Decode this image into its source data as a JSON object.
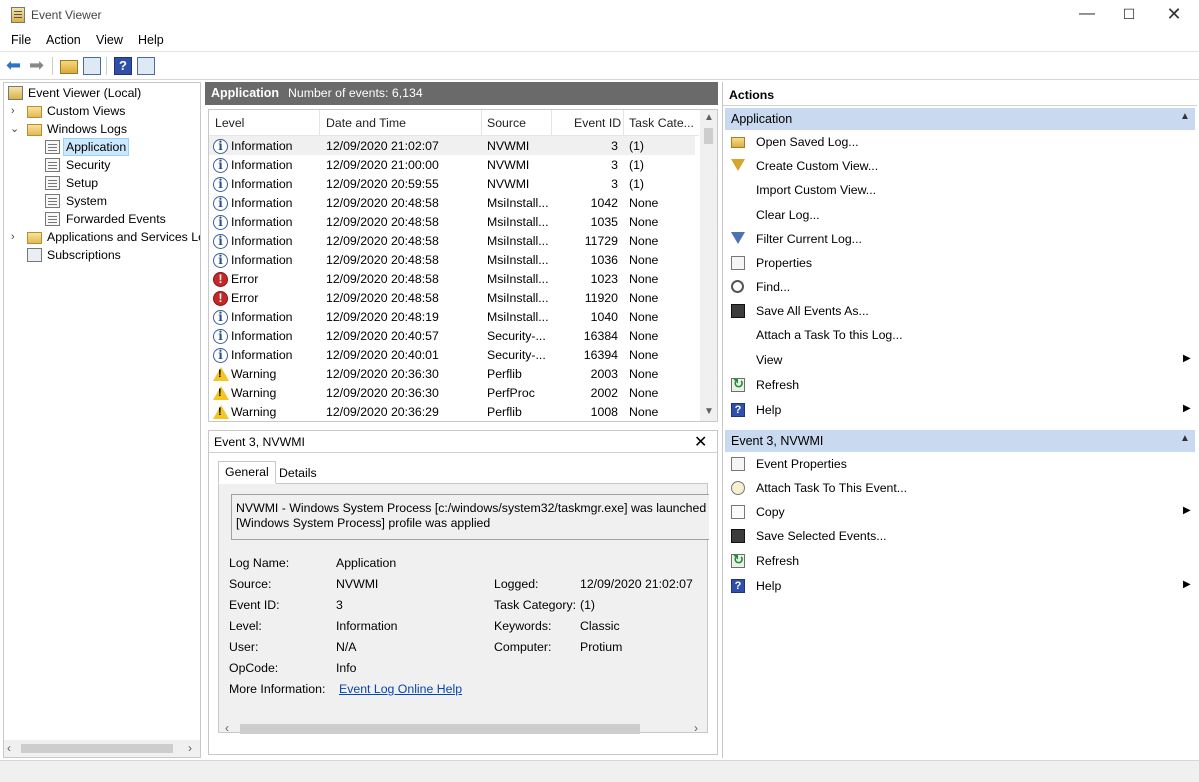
{
  "window": {
    "title": "Event Viewer",
    "min": "—",
    "max": "☐",
    "close": "✕"
  },
  "menu": [
    "File",
    "Action",
    "View",
    "Help"
  ],
  "tree": {
    "items": [
      {
        "label": "Event Viewer (Local)"
      },
      {
        "label": "Custom Views"
      },
      {
        "label": "Windows Logs"
      },
      {
        "label": "Application"
      },
      {
        "label": "Security"
      },
      {
        "label": "Setup"
      },
      {
        "label": "System"
      },
      {
        "label": "Forwarded Events"
      },
      {
        "label": "Applications and Services Logs"
      },
      {
        "label": "Subscriptions"
      }
    ]
  },
  "events_header": {
    "log": "Application",
    "count": "Number of events: 6,134"
  },
  "columns": [
    "Level",
    "Date and Time",
    "Source",
    "Event ID",
    "Task Cate..."
  ],
  "events": [
    {
      "level": "Information",
      "icon": "info-icon",
      "date": "12/09/2020 21:02:07",
      "source": "NVWMI",
      "id": "3",
      "task": "(1)"
    },
    {
      "level": "Information",
      "icon": "info-icon",
      "date": "12/09/2020 21:00:00",
      "source": "NVWMI",
      "id": "3",
      "task": "(1)"
    },
    {
      "level": "Information",
      "icon": "info-icon",
      "date": "12/09/2020 20:59:55",
      "source": "NVWMI",
      "id": "3",
      "task": "(1)"
    },
    {
      "level": "Information",
      "icon": "info-icon",
      "date": "12/09/2020 20:48:58",
      "source": "MsiInstall...",
      "id": "1042",
      "task": "None"
    },
    {
      "level": "Information",
      "icon": "info-icon",
      "date": "12/09/2020 20:48:58",
      "source": "MsiInstall...",
      "id": "1035",
      "task": "None"
    },
    {
      "level": "Information",
      "icon": "info-icon",
      "date": "12/09/2020 20:48:58",
      "source": "MsiInstall...",
      "id": "11729",
      "task": "None"
    },
    {
      "level": "Information",
      "icon": "info-icon",
      "date": "12/09/2020 20:48:58",
      "source": "MsiInstall...",
      "id": "1036",
      "task": "None"
    },
    {
      "level": "Error",
      "icon": "error-icon",
      "date": "12/09/2020 20:48:58",
      "source": "MsiInstall...",
      "id": "1023",
      "task": "None"
    },
    {
      "level": "Error",
      "icon": "error-icon",
      "date": "12/09/2020 20:48:58",
      "source": "MsiInstall...",
      "id": "11920",
      "task": "None"
    },
    {
      "level": "Information",
      "icon": "info-icon",
      "date": "12/09/2020 20:48:19",
      "source": "MsiInstall...",
      "id": "1040",
      "task": "None"
    },
    {
      "level": "Information",
      "icon": "info-icon",
      "date": "12/09/2020 20:40:57",
      "source": "Security-...",
      "id": "16384",
      "task": "None"
    },
    {
      "level": "Information",
      "icon": "info-icon",
      "date": "12/09/2020 20:40:01",
      "source": "Security-...",
      "id": "16394",
      "task": "None"
    },
    {
      "level": "Warning",
      "icon": "warning-icon",
      "date": "12/09/2020 20:36:30",
      "source": "Perflib",
      "id": "2003",
      "task": "None"
    },
    {
      "level": "Warning",
      "icon": "warning-icon",
      "date": "12/09/2020 20:36:30",
      "source": "PerfProc",
      "id": "2002",
      "task": "None"
    },
    {
      "level": "Warning",
      "icon": "warning-icon",
      "date": "12/09/2020 20:36:29",
      "source": "Perflib",
      "id": "1008",
      "task": "None"
    }
  ],
  "detail": {
    "title": "Event 3, NVWMI",
    "close": "✕",
    "tabs": [
      "General",
      "Details"
    ],
    "message_line1": "NVWMI - Windows System Process [c:/windows/system32/taskmgr.exe] was launched ar",
    "message_line2": "[Windows System Process] profile was applied",
    "labels": {
      "log_name": "Log Name:",
      "source": "Source:",
      "event_id": "Event ID:",
      "level": "Level:",
      "user": "User:",
      "opcode": "OpCode:",
      "more_info": "More Information:",
      "logged": "Logged:",
      "task_category": "Task Category:",
      "keywords": "Keywords:",
      "computer": "Computer:"
    },
    "values": {
      "log_name": "Application",
      "source": "NVWMI",
      "event_id": "3",
      "level": "Information",
      "user": "N/A",
      "opcode": "Info",
      "more_info": "Event Log Online Help",
      "logged": "12/09/2020 21:02:07",
      "task_category": "(1)",
      "keywords": "Classic",
      "computer": "Protium"
    }
  },
  "actions": {
    "title": "Actions",
    "section1": "Application",
    "section1_items": [
      "Open Saved Log...",
      "Create Custom View...",
      "Import Custom View...",
      "Clear Log...",
      "Filter Current Log...",
      "Properties",
      "Find...",
      "Save All Events As...",
      "Attach a Task To this Log...",
      "View",
      "Refresh",
      "Help"
    ],
    "section2": "Event 3, NVWMI",
    "section2_items": [
      "Event Properties",
      "Attach Task To This Event...",
      "Copy",
      "Save Selected Events...",
      "Refresh",
      "Help"
    ]
  }
}
